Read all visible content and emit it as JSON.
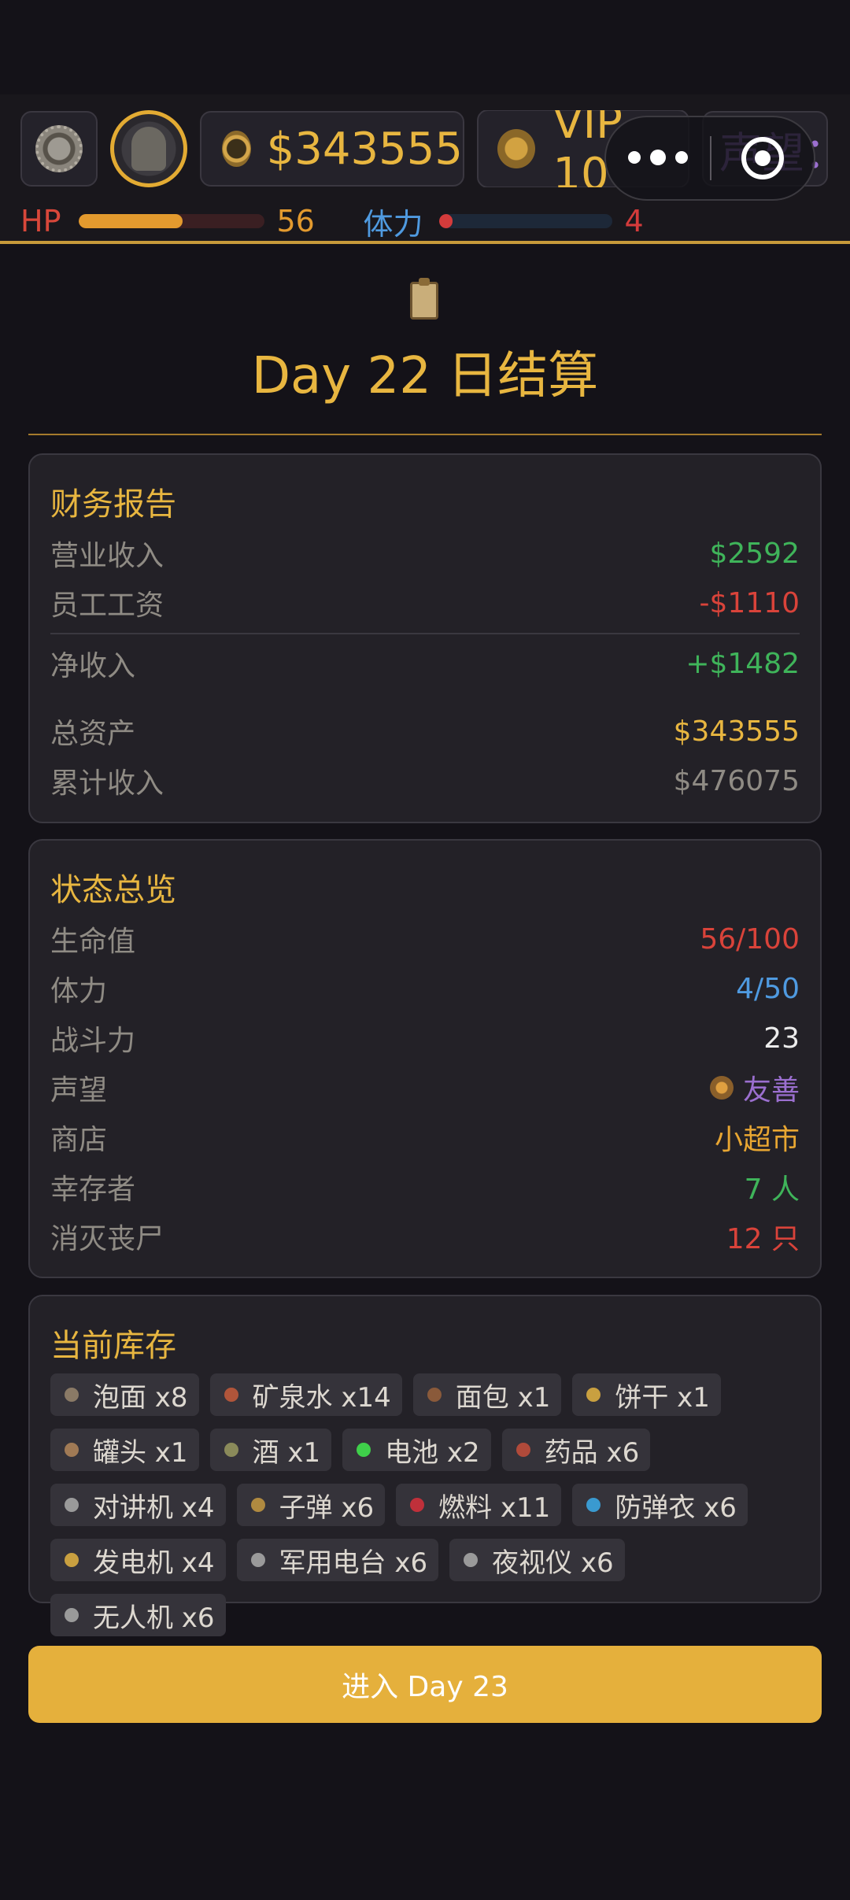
{
  "hud": {
    "money": "$343555",
    "vip": "VIP 10",
    "reputation_label": "声望：",
    "hp_label": "HP",
    "hp_value": "56",
    "hp_fraction": 0.56,
    "stamina_label": "体力",
    "stamina_value": "4",
    "stamina_fraction": 0.08
  },
  "title": "Day 22 日结算",
  "finance": {
    "title": "财务报告",
    "rows": [
      {
        "label": "营业收入",
        "value": "$2592"
      },
      {
        "label": "员工工资",
        "value": "-$1110"
      },
      {
        "label": "净收入",
        "value": "+$1482"
      },
      {
        "label": "总资产",
        "value": "$343555"
      },
      {
        "label": "累计收入",
        "value": "$476075"
      }
    ]
  },
  "status": {
    "title": "状态总览",
    "rows": [
      {
        "label": "生命值",
        "value": "56/100"
      },
      {
        "label": "体力",
        "value": "4/50"
      },
      {
        "label": "战斗力",
        "value": "23"
      },
      {
        "label": "声望",
        "value": "友善"
      },
      {
        "label": "商店",
        "value": "小超市"
      },
      {
        "label": "幸存者",
        "value": "7 人"
      },
      {
        "label": "消灭丧尸",
        "value": "12 只"
      }
    ]
  },
  "inventory": {
    "title": "当前库存",
    "items": [
      {
        "label": "泡面 x8",
        "icon": "instant-noodles-icon",
        "color": "#8a7a66"
      },
      {
        "label": "矿泉水 x14",
        "icon": "water-bottle-icon",
        "color": "#b0553a"
      },
      {
        "label": "面包 x1",
        "icon": "bread-icon",
        "color": "#8a5a3a"
      },
      {
        "label": "饼干 x1",
        "icon": "biscuit-icon",
        "color": "#c9a040"
      },
      {
        "label": "罐头 x1",
        "icon": "canned-food-icon",
        "color": "#a07a55"
      },
      {
        "label": "酒 x1",
        "icon": "liquor-icon",
        "color": "#8a8a5a"
      },
      {
        "label": "电池 x2",
        "icon": "battery-icon",
        "color": "#3fd04a"
      },
      {
        "label": "药品 x6",
        "icon": "medicine-icon",
        "color": "#b04a3a"
      },
      {
        "label": "对讲机 x4",
        "icon": "walkie-talkie-icon",
        "color": "#9a9a9a"
      },
      {
        "label": "子弹 x6",
        "icon": "bullet-icon",
        "color": "#b08a40"
      },
      {
        "label": "燃料 x11",
        "icon": "fuel-icon",
        "color": "#c0303a"
      },
      {
        "label": "防弹衣 x6",
        "icon": "body-armor-icon",
        "color": "#3a9ad0"
      },
      {
        "label": "发电机 x4",
        "icon": "generator-icon",
        "color": "#c9a040"
      },
      {
        "label": "军用电台 x6",
        "icon": "military-radio-icon",
        "color": "#9a9a9a"
      },
      {
        "label": "夜视仪 x6",
        "icon": "night-vision-icon",
        "color": "#9a9a9a"
      },
      {
        "label": "无人机 x6",
        "icon": "drone-icon",
        "color": "#9a9a9a"
      }
    ]
  },
  "next_button": "进入 Day 23"
}
